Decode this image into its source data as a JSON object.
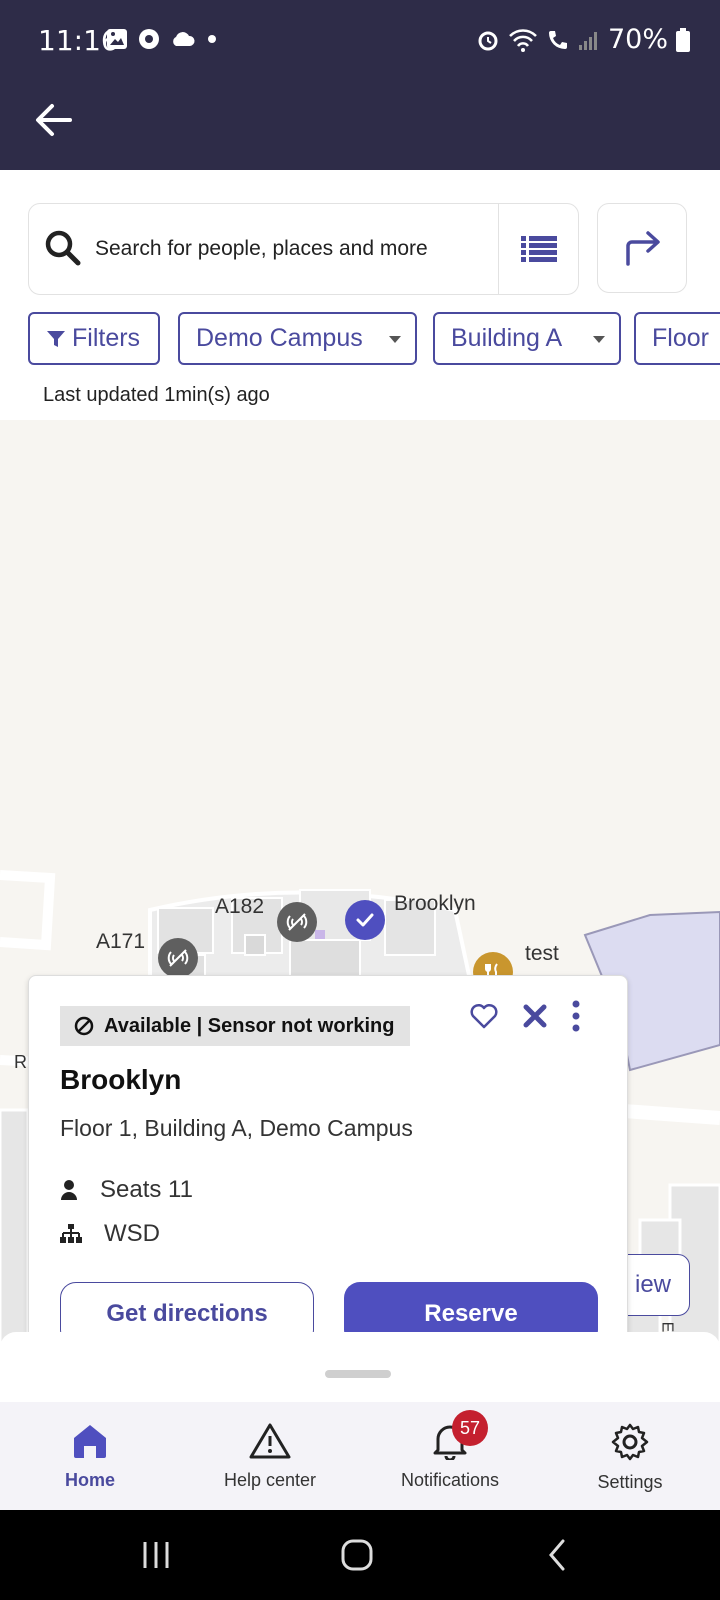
{
  "status_bar": {
    "time": "11:16",
    "battery": "70%"
  },
  "search": {
    "placeholder": "Search for people, places and more"
  },
  "filters": {
    "filters_label": "Filters",
    "campus": "Demo Campus",
    "building": "Building A",
    "floor": "Floor"
  },
  "last_updated": "Last updated 1min(s) ago",
  "map": {
    "labels": {
      "a182": "A182",
      "brooklyn": "Brooklyn",
      "a171": "A171",
      "test": "test",
      "r": "R",
      "e": "E"
    }
  },
  "details_card": {
    "status": "Available | Sensor not working",
    "title": "Brooklyn",
    "location": "Floor 1, Building A, Demo Campus",
    "seats": "Seats 11",
    "org": "WSD",
    "directions_button": "Get directions",
    "reserve_button": "Reserve"
  },
  "partial_view_button": "iew",
  "bottom_nav": {
    "items": [
      {
        "label": "Home",
        "icon": "home-icon",
        "active": true
      },
      {
        "label": "Help center",
        "icon": "warning-icon",
        "active": false
      },
      {
        "label": "Notifications",
        "icon": "bell-icon",
        "active": false,
        "badge": "57"
      },
      {
        "label": "Settings",
        "icon": "gear-icon",
        "active": false
      }
    ]
  },
  "colors": {
    "header_bg": "#2e2c48",
    "accent": "#4a4a9e",
    "primary_button": "#4f4fbf",
    "badge_red": "#c4202f",
    "map_bg": "#f7f5f1"
  }
}
